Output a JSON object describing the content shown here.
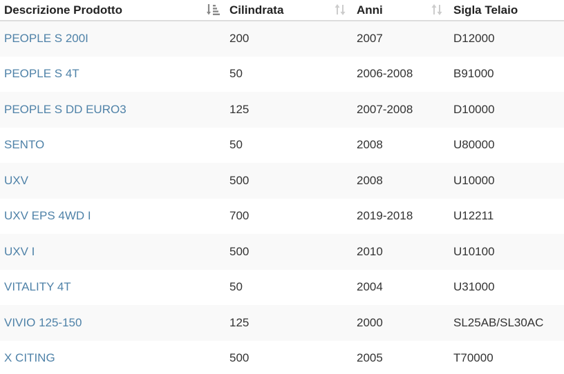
{
  "columns": [
    {
      "label": "Descrizione Prodotto",
      "sort": "ascending"
    },
    {
      "label": "Cilindrata",
      "sort": "none"
    },
    {
      "label": "Anni",
      "sort": "none"
    },
    {
      "label": "Sigla Telaio",
      "sort": "none"
    }
  ],
  "rows": [
    {
      "product": "PEOPLE S 200I",
      "cc": "200",
      "years": "2007",
      "frame": "D12000"
    },
    {
      "product": "PEOPLE S 4T",
      "cc": "50",
      "years": "2006-2008",
      "frame": "B91000"
    },
    {
      "product": "PEOPLE S DD EURO3",
      "cc": "125",
      "years": "2007-2008",
      "frame": "D10000"
    },
    {
      "product": "SENTO",
      "cc": "50",
      "years": "2008",
      "frame": "U80000"
    },
    {
      "product": "UXV",
      "cc": "500",
      "years": "2008",
      "frame": "U10000"
    },
    {
      "product": "UXV EPS 4WD I",
      "cc": "700",
      "years": "2019-2018",
      "frame": "U12211"
    },
    {
      "product": "UXV I",
      "cc": "500",
      "years": "2010",
      "frame": "U10100"
    },
    {
      "product": "VITALITY 4T",
      "cc": "50",
      "years": "2004",
      "frame": "U31000"
    },
    {
      "product": "VIVIO 125-150",
      "cc": "125",
      "years": "2000",
      "frame": "SL25AB/SL30AC"
    },
    {
      "product": "X CITING",
      "cc": "500",
      "years": "2005",
      "frame": "T70000"
    }
  ],
  "colors": {
    "link": "#4f82a8",
    "text": "#333333",
    "stripe": "#f9f9f9",
    "sort_icon_active": "#888888",
    "sort_icon_inactive": "#cccccc"
  },
  "icons": {
    "active_sort": "sort-amount-asc-icon",
    "inactive_sort": "sort-both-icon"
  }
}
